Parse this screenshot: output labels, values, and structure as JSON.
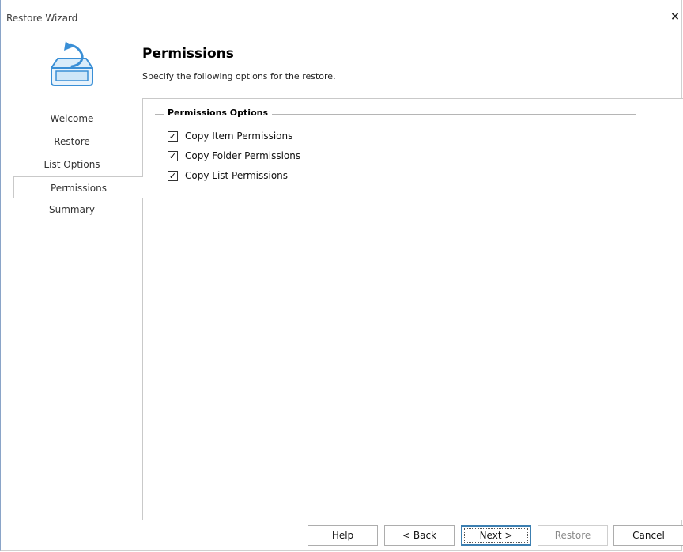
{
  "window": {
    "title": "Restore Wizard",
    "close_label": "×"
  },
  "header": {
    "title": "Permissions",
    "subtitle": "Specify the following options for the restore."
  },
  "nav": {
    "items": [
      {
        "label": "Welcome"
      },
      {
        "label": "Restore"
      },
      {
        "label": "List Options"
      },
      {
        "label": "Permissions"
      },
      {
        "label": "Summary"
      }
    ],
    "active_index": 3
  },
  "options": {
    "group_label": "Permissions Options",
    "items": [
      {
        "label": "Copy Item Permissions",
        "checked": true
      },
      {
        "label": "Copy Folder Permissions",
        "checked": true
      },
      {
        "label": "Copy List Permissions",
        "checked": true
      }
    ]
  },
  "buttons": {
    "help": "Help",
    "back": "< Back",
    "next": "Next >",
    "restore": "Restore",
    "cancel": "Cancel"
  },
  "colors": {
    "icon_blue": "#3a8fd6",
    "icon_fill": "#d9ecfa"
  }
}
